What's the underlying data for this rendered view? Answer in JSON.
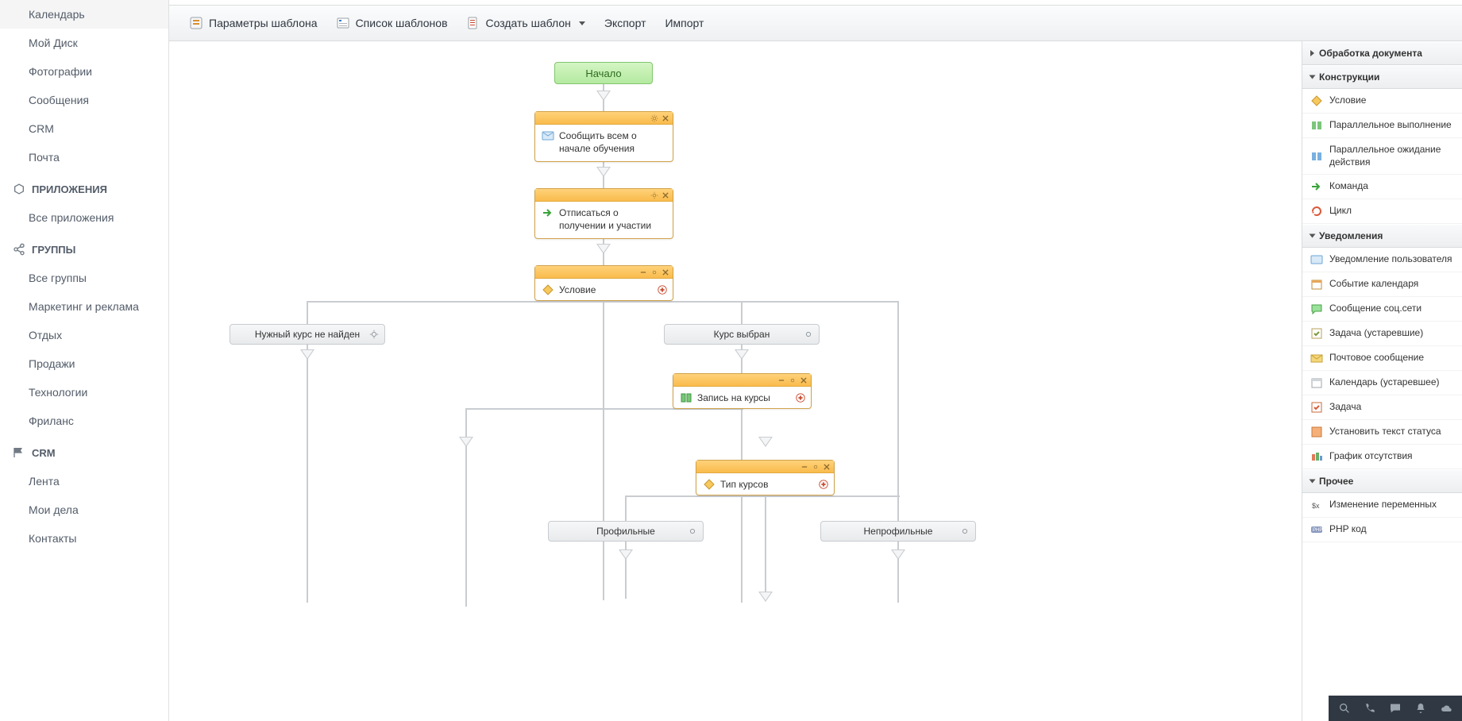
{
  "sidebar": {
    "items_top": [
      "Календарь",
      "Мой Диск",
      "Фотографии",
      "Сообщения",
      "CRM",
      "Почта"
    ],
    "section_apps": "ПРИЛОЖЕНИЯ",
    "apps_items": [
      "Все приложения"
    ],
    "section_groups": "ГРУППЫ",
    "groups_items": [
      "Все группы",
      "Маркетинг и реклама",
      "Отдых",
      "Продажи",
      "Технологии",
      "Фриланс"
    ],
    "section_crm": "CRM",
    "crm_items": [
      "Лента",
      "Мои дела",
      "Контакты"
    ]
  },
  "toolbar": {
    "params": "Параметры шаблона",
    "list": "Список шаблонов",
    "create": "Создать шаблон",
    "export": "Экспорт",
    "import": "Импорт"
  },
  "flow": {
    "start": "Начало",
    "notify": "Сообщить всем о начале обучения",
    "unsubscribe": "Отписаться о получении и участии",
    "condition": "Условие",
    "branch_not_found": "Нужный курс не найден",
    "branch_selected": "Курс выбран",
    "enroll": "Запись на курсы",
    "course_type": "Тип курсов",
    "profile": "Профильные",
    "nonprofile": "Непрофильные"
  },
  "palette": {
    "doc_processing": "Обработка документа",
    "constructs": "Конструкции",
    "constructs_items": [
      "Условие",
      "Параллельное выполнение",
      "Параллельное ожидание действия",
      "Команда",
      "Цикл"
    ],
    "notifications": "Уведомления",
    "notifications_items": [
      "Уведомление пользователя",
      "Событие календаря",
      "Сообщение соц.сети",
      "Задача (устаревшие)",
      "Почтовое сообщение",
      "Календарь (устаревшее)",
      "Задача",
      "Установить текст статуса",
      "График отсутствия"
    ],
    "other": "Прочее",
    "other_items": [
      "Изменение переменных",
      "PHP код"
    ]
  }
}
